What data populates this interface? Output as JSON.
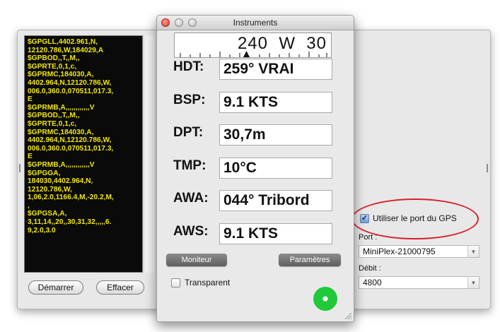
{
  "back_window": {
    "nmea_lines": [
      "$GPGLL,4402.961,N,",
      "12120.786,W,184029,A",
      "$GPBOD,,T,,M,,",
      "$GPRTE,0,1,c,",
      "$GPRMC,184030,A,",
      "4402.964,N,12120.786,W,",
      "006.0,360.0,070511,017.3,",
      "E",
      "$GPRMB,A,,,,,,,,,,,,V",
      "$GPBOD,,T,,M,,",
      "$GPRTE,0,1,c,",
      "$GPRMC,184030,A,",
      "4402.964,N,12120.786,W,",
      "006.0,360.0,070511,017.3,",
      "E",
      "$GPRMB,A,,,,,,,,,,,,V",
      "$GPGGA,",
      "184030,4402.964,N,",
      "12120.786,W,",
      "1,06,2.0,1166.4,M,-20.2,M,",
      ",",
      "$GPGSA,A,",
      "3,11,14,,20,,30,31,32,,,,,6.",
      "9,2.0,3.0"
    ],
    "start_button": "Démarrer",
    "clear_button": "Effacer",
    "use_gps_label": "Utiliser le port du GPS",
    "use_gps_checked": true,
    "port_label": "Port :",
    "port_value": "MiniPlex-21000795",
    "baud_label": "Débit :",
    "baud_value": "4800"
  },
  "instruments": {
    "title": "Instruments",
    "compass_text": "240  W  30",
    "metrics": [
      {
        "label": "HDT:",
        "value": "259° VRAI"
      },
      {
        "label": "BSP:",
        "value": "9.1 KTS"
      },
      {
        "label": "DPT:",
        "value": "30,7m"
      },
      {
        "label": "TMP:",
        "value": "10°C"
      },
      {
        "label": "AWA:",
        "value": "044° Tribord"
      },
      {
        "label": "AWS:",
        "value": "9.1 KTS"
      }
    ],
    "monitor_button": "Moniteur",
    "settings_button": "Paramètres",
    "transparent_label": "Transparent",
    "transparent_checked": false
  },
  "colors": {
    "nmea_text": "#f2e800",
    "highlight_ellipse": "#d81e2a",
    "status_light": "#1fc93a"
  },
  "icons": [
    "close-icon",
    "minimize-icon",
    "zoom-icon",
    "dropdown-arrow-icon",
    "resize-grip-icon",
    "status-light-icon"
  ]
}
